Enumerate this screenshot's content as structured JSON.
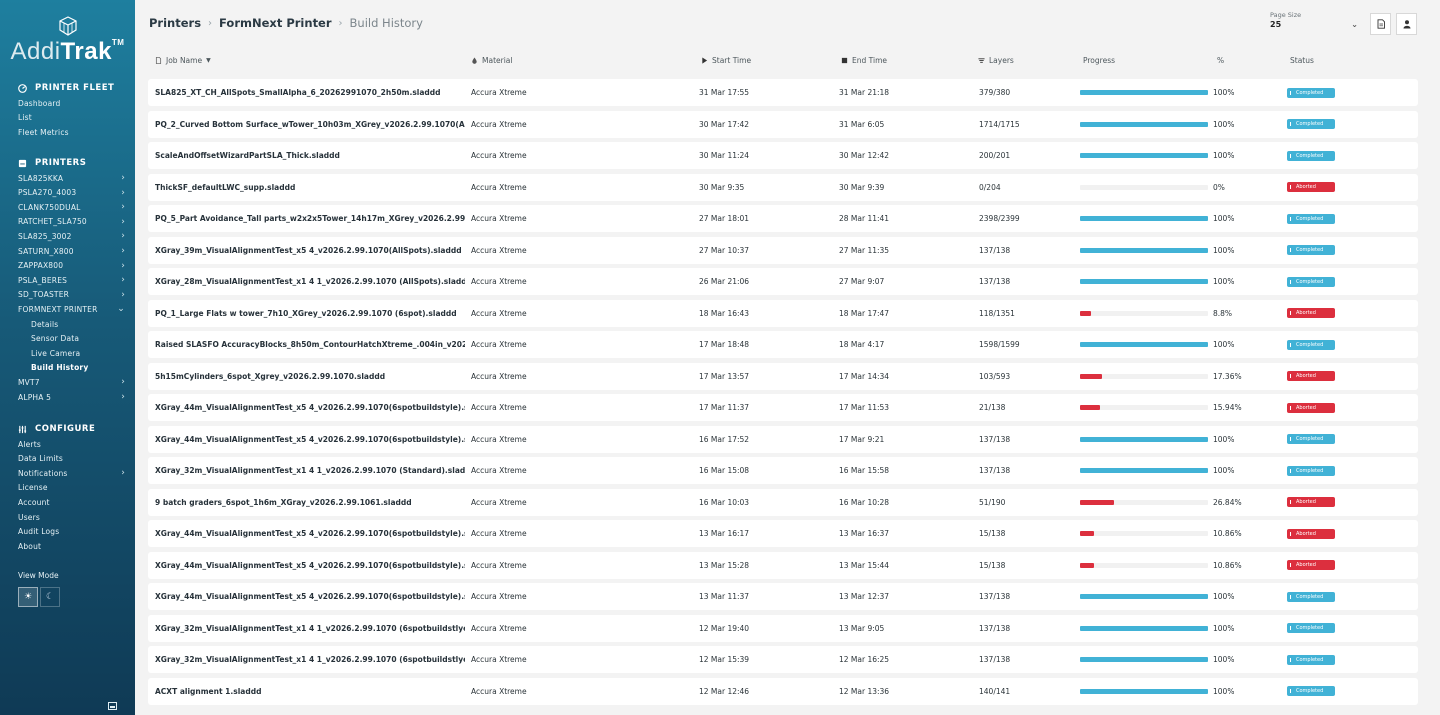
{
  "brand": {
    "name_a": "Addi",
    "name_b": "Trak",
    "tm": "TM"
  },
  "sidebar": {
    "fleet_heading": "PRINTER FLEET",
    "fleet_items": [
      "Dashboard",
      "List",
      "Fleet Metrics"
    ],
    "printers_heading": "PRINTERS",
    "printers": [
      "SLA825KKA",
      "PSLA270_4003",
      "CLANK750DUAL",
      "RATCHET_SLA750",
      "SLA825_3002",
      "SATURN_X800",
      "ZAPPAX800",
      "PSLA_BERES",
      "SD_TOASTER",
      "FORMNEXT PRINTER"
    ],
    "printer_sub": [
      "Details",
      "Sensor Data",
      "Live Camera",
      "Build History"
    ],
    "printers_after": [
      "MVT7",
      "ALPHA 5"
    ],
    "configure_heading": "CONFIGURE",
    "configure_items": [
      "Alerts",
      "Data Limits",
      "Notifications",
      "License",
      "Account",
      "Users",
      "Audit Logs",
      "About"
    ],
    "view_mode": "View Mode"
  },
  "breadcrumb": {
    "a": "Printers",
    "b": "FormNext Printer",
    "c": "Build History"
  },
  "page_size": {
    "label": "Page Size",
    "value": "25"
  },
  "columns": {
    "job": "Job Name",
    "material": "Material",
    "start": "Start Time",
    "end": "End Time",
    "layers": "Layers",
    "progress": "Progress",
    "pct": "%",
    "status": "Status"
  },
  "colors": {
    "completed": "#41b2d6",
    "aborted": "#dc2f3e"
  },
  "jobs": [
    {
      "name": "SLA825_XT_CH_AllSpots_SmallAlpha_6_20262991070_2h50m.sladdd",
      "material": "Accura Xtreme",
      "start": "31 Mar 17:55",
      "end": "31 Mar 21:18",
      "layers": "379/380",
      "progress": 100,
      "pct": "100%",
      "status": "Completed"
    },
    {
      "name": "PQ_2_Curved Bottom Surface_wTower_10h03m_XGrey_v2026.2.99.1070(AllSpots).sl...",
      "material": "Accura Xtreme",
      "start": "30 Mar 17:42",
      "end": "31 Mar 6:05",
      "layers": "1714/1715",
      "progress": 100,
      "pct": "100%",
      "status": "Completed"
    },
    {
      "name": "ScaleAndOffsetWizardPartSLA_Thick.sladdd",
      "material": "Accura Xtreme",
      "start": "30 Mar 11:24",
      "end": "30 Mar 12:42",
      "layers": "200/201",
      "progress": 100,
      "pct": "100%",
      "status": "Completed"
    },
    {
      "name": "ThickSF_defaultLWC_supp.sladdd",
      "material": "Accura Xtreme",
      "start": "30 Mar 9:35",
      "end": "30 Mar 9:39",
      "layers": "0/204",
      "progress": 0,
      "pct": "0%",
      "status": "Aborted"
    },
    {
      "name": "PQ_5_Part Avoidance_Tall parts_w2x2x5Tower_14h17m_XGrey_v2026.2.99.1070(Al...",
      "material": "Accura Xtreme",
      "start": "27 Mar 18:01",
      "end": "28 Mar 11:41",
      "layers": "2398/2399",
      "progress": 100,
      "pct": "100%",
      "status": "Completed"
    },
    {
      "name": "XGray_39m_VisualAlignmentTest_x5 4_v2026.2.99.1070(AllSpots).sladdd",
      "material": "Accura Xtreme",
      "start": "27 Mar 10:37",
      "end": "27 Mar 11:35",
      "layers": "137/138",
      "progress": 100,
      "pct": "100%",
      "status": "Completed"
    },
    {
      "name": "XGray_28m_VisualAlignmentTest_x1 4 1_v2026.2.99.1070 (AllSpots).sladdd",
      "material": "Accura Xtreme",
      "start": "26 Mar 21:06",
      "end": "27 Mar 9:07",
      "layers": "137/138",
      "progress": 100,
      "pct": "100%",
      "status": "Completed"
    },
    {
      "name": "PQ_1_Large Flats w tower_7h10_XGrey_v2026.2.99.1070 (6spot).sladdd",
      "material": "Accura Xtreme",
      "start": "18 Mar 16:43",
      "end": "18 Mar 17:47",
      "layers": "118/1351",
      "progress": 8.8,
      "pct": "8.8%",
      "status": "Aborted"
    },
    {
      "name": "Raised SLASFO AccuracyBlocks_8h50m_ContourHatchXtreme_.004in_v2026.2.99.10...",
      "material": "Accura Xtreme",
      "start": "17 Mar 18:48",
      "end": "18 Mar 4:17",
      "layers": "1598/1599",
      "progress": 100,
      "pct": "100%",
      "status": "Completed"
    },
    {
      "name": "5h15mCylinders_6spot_Xgrey_v2026.2.99.1070.sladdd",
      "material": "Accura Xtreme",
      "start": "17 Mar 13:57",
      "end": "17 Mar 14:34",
      "layers": "103/593",
      "progress": 17.36,
      "pct": "17.36%",
      "status": "Aborted"
    },
    {
      "name": "XGray_44m_VisualAlignmentTest_x5 4_v2026.2.99.1070(6spotbuildstyle).sladdd",
      "material": "Accura Xtreme",
      "start": "17 Mar 11:37",
      "end": "17 Mar 11:53",
      "layers": "21/138",
      "progress": 15.94,
      "pct": "15.94%",
      "status": "Aborted"
    },
    {
      "name": "XGray_44m_VisualAlignmentTest_x5 4_v2026.2.99.1070(6spotbuildstyle).sladdd",
      "material": "Accura Xtreme",
      "start": "16 Mar 17:52",
      "end": "17 Mar 9:21",
      "layers": "137/138",
      "progress": 100,
      "pct": "100%",
      "status": "Completed"
    },
    {
      "name": "XGray_32m_VisualAlignmentTest_x1 4 1_v2026.2.99.1070 (Standard).sladdd",
      "material": "Accura Xtreme",
      "start": "16 Mar 15:08",
      "end": "16 Mar 15:58",
      "layers": "137/138",
      "progress": 100,
      "pct": "100%",
      "status": "Completed"
    },
    {
      "name": "9 batch graders_6spot_1h6m_XGray_v2026.2.99.1061.sladdd",
      "material": "Accura Xtreme",
      "start": "16 Mar 10:03",
      "end": "16 Mar 10:28",
      "layers": "51/190",
      "progress": 26.84,
      "pct": "26.84%",
      "status": "Aborted"
    },
    {
      "name": "XGray_44m_VisualAlignmentTest_x5 4_v2026.2.99.1070(6spotbuildstyle).sladdd",
      "material": "Accura Xtreme",
      "start": "13 Mar 16:17",
      "end": "13 Mar 16:37",
      "layers": "15/138",
      "progress": 10.86,
      "pct": "10.86%",
      "status": "Aborted"
    },
    {
      "name": "XGray_44m_VisualAlignmentTest_x5 4_v2026.2.99.1070(6spotbuildstyle).sladdd",
      "material": "Accura Xtreme",
      "start": "13 Mar 15:28",
      "end": "13 Mar 15:44",
      "layers": "15/138",
      "progress": 10.86,
      "pct": "10.86%",
      "status": "Aborted"
    },
    {
      "name": "XGray_44m_VisualAlignmentTest_x5 4_v2026.2.99.1070(6spotbuildstyle).sladdd",
      "material": "Accura Xtreme",
      "start": "13 Mar 11:37",
      "end": "13 Mar 12:37",
      "layers": "137/138",
      "progress": 100,
      "pct": "100%",
      "status": "Completed"
    },
    {
      "name": "XGray_32m_VisualAlignmentTest_x1 4 1_v2026.2.99.1070 (6spotbuildstlye).sladdd",
      "material": "Accura Xtreme",
      "start": "12 Mar 19:40",
      "end": "13 Mar 9:05",
      "layers": "137/138",
      "progress": 100,
      "pct": "100%",
      "status": "Completed"
    },
    {
      "name": "XGray_32m_VisualAlignmentTest_x1 4 1_v2026.2.99.1070 (6spotbuildstlye).sladdd",
      "material": "Accura Xtreme",
      "start": "12 Mar 15:39",
      "end": "12 Mar 16:25",
      "layers": "137/138",
      "progress": 100,
      "pct": "100%",
      "status": "Completed"
    },
    {
      "name": "ACXT alignment 1.sladdd",
      "material": "Accura Xtreme",
      "start": "12 Mar 12:46",
      "end": "12 Mar 13:36",
      "layers": "140/141",
      "progress": 100,
      "pct": "100%",
      "status": "Completed"
    }
  ]
}
